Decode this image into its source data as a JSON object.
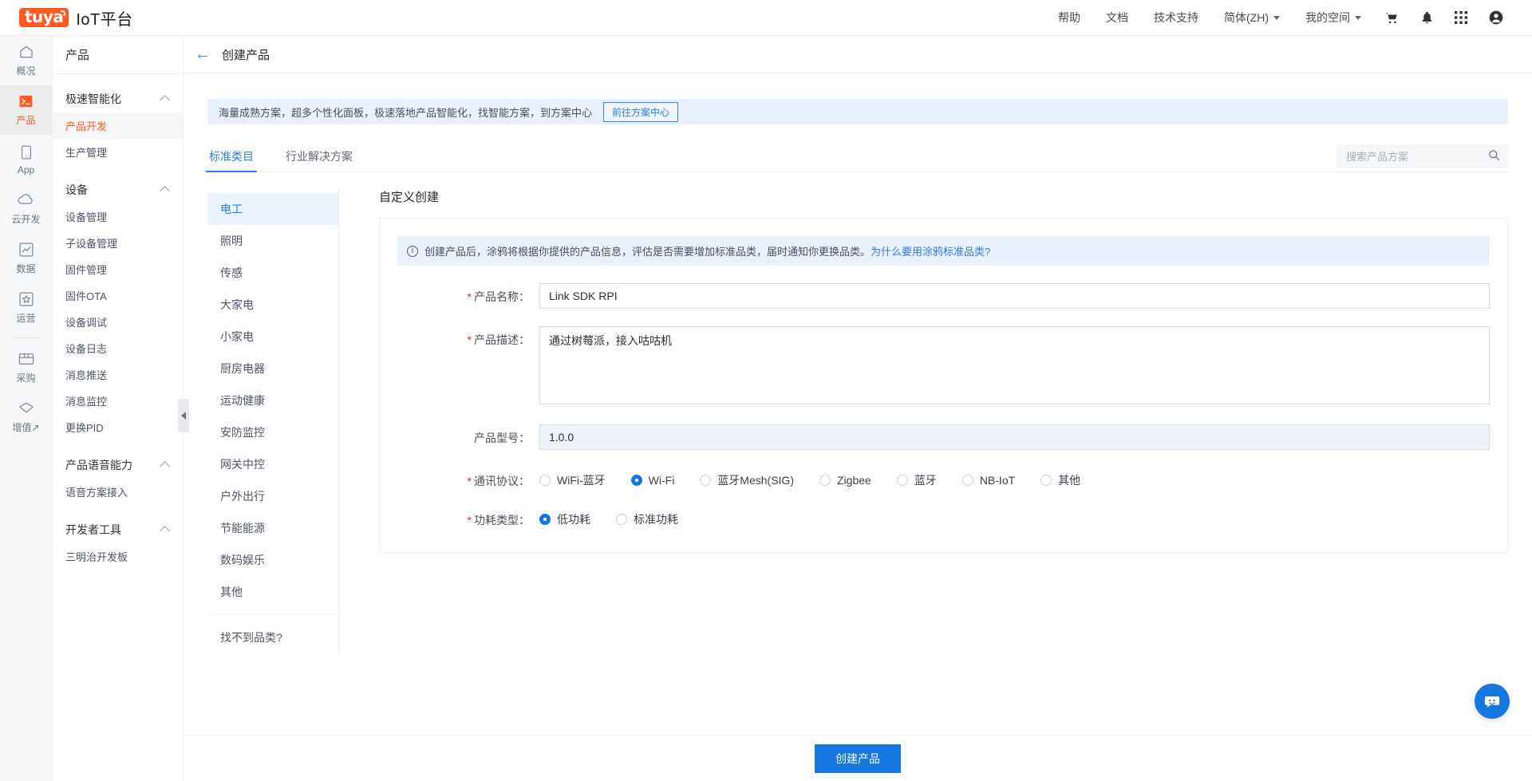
{
  "header": {
    "logo_badge": "tuya",
    "logo_text": "IoT平台",
    "nav": [
      {
        "label": "帮助",
        "name": "nav-help",
        "caret": false
      },
      {
        "label": "文档",
        "name": "nav-docs",
        "caret": false
      },
      {
        "label": "技术支持",
        "name": "nav-support",
        "caret": false
      },
      {
        "label": "简体(ZH)",
        "name": "nav-language",
        "caret": true
      },
      {
        "label": "我的空间",
        "name": "nav-workspace",
        "caret": true
      }
    ],
    "icons": [
      "cart-icon",
      "bell-icon",
      "apps-grid-icon",
      "user-avatar-icon"
    ]
  },
  "rail": {
    "items": [
      {
        "label": "概况",
        "icon": "home-icon",
        "active": false
      },
      {
        "label": "产品",
        "icon": "terminal-icon",
        "active": true
      },
      {
        "label": "App",
        "icon": "mobile-icon",
        "active": false
      },
      {
        "label": "云开发",
        "icon": "cloud-icon",
        "active": false
      },
      {
        "label": "数据",
        "icon": "chart-icon",
        "active": false
      },
      {
        "label": "运营",
        "icon": "badge-star-icon",
        "active": false
      }
    ],
    "items_bottom": [
      {
        "label": "采购",
        "icon": "box-icon",
        "active": false
      },
      {
        "label": "增值↗",
        "icon": "diamond-icon",
        "active": false
      }
    ]
  },
  "sidebar": {
    "title": "产品",
    "groups": [
      {
        "label": "极速智能化",
        "items": [
          {
            "label": "产品开发",
            "active": true
          },
          {
            "label": "生产管理",
            "active": false
          }
        ]
      },
      {
        "label": "设备",
        "items": [
          {
            "label": "设备管理",
            "active": false
          },
          {
            "label": "子设备管理",
            "active": false
          },
          {
            "label": "固件管理",
            "active": false
          },
          {
            "label": "固件OTA",
            "active": false
          },
          {
            "label": "设备调试",
            "active": false
          },
          {
            "label": "设备日志",
            "active": false
          },
          {
            "label": "消息推送",
            "active": false
          },
          {
            "label": "消息监控",
            "active": false
          },
          {
            "label": "更换PID",
            "active": false
          }
        ]
      },
      {
        "label": "产品语音能力",
        "items": [
          {
            "label": "语音方案接入",
            "active": false
          }
        ]
      },
      {
        "label": "开发者工具",
        "items": [
          {
            "label": "三明治开发板",
            "active": false
          }
        ]
      }
    ]
  },
  "page": {
    "title": "创建产品",
    "back_icon": "arrow-left-icon"
  },
  "promo": {
    "text": "海量成熟方案，超多个性化面板，极速落地产品智能化，找智能方案，到方案中心",
    "button": "前往方案中心"
  },
  "tabs": [
    {
      "label": "标准类目",
      "active": true
    },
    {
      "label": "行业解决方案",
      "active": false
    }
  ],
  "search": {
    "placeholder": "搜索产品方案",
    "value": "",
    "icon": "search-icon"
  },
  "categories": [
    {
      "label": "电工",
      "active": true
    },
    {
      "label": "照明",
      "active": false
    },
    {
      "label": "传感",
      "active": false
    },
    {
      "label": "大家电",
      "active": false
    },
    {
      "label": "小家电",
      "active": false
    },
    {
      "label": "厨房电器",
      "active": false
    },
    {
      "label": "运动健康",
      "active": false
    },
    {
      "label": "安防监控",
      "active": false
    },
    {
      "label": "网关中控",
      "active": false
    },
    {
      "label": "户外出行",
      "active": false
    },
    {
      "label": "节能能源",
      "active": false
    },
    {
      "label": "数码娱乐",
      "active": false
    },
    {
      "label": "其他",
      "active": false
    }
  ],
  "category_footer_link": "找不到品类?",
  "form": {
    "title": "自定义创建",
    "notice": {
      "icon": "info-icon",
      "text": "创建产品后，涂鸦将根据你提供的产品信息，评估是否需要增加标准品类，届时通知你更换品类。",
      "link": "为什么要用涂鸦标准品类?"
    },
    "product_name": {
      "label": "产品名称：",
      "required": true,
      "value": "Link SDK RPI",
      "placeholder": ""
    },
    "product_desc": {
      "label": "产品描述：",
      "required": true,
      "value": "通过树莓派，接入咕咕机",
      "placeholder": ""
    },
    "product_model": {
      "label": "产品型号：",
      "required": false,
      "value": "1.0.0",
      "placeholder": ""
    },
    "protocol": {
      "label": "通讯协议：",
      "required": true,
      "options": [
        {
          "label": "WiFi-蓝牙",
          "selected": false
        },
        {
          "label": "Wi-Fi",
          "selected": true
        },
        {
          "label": "蓝牙Mesh(SIG)",
          "selected": false
        },
        {
          "label": "Zigbee",
          "selected": false
        },
        {
          "label": "蓝牙",
          "selected": false
        },
        {
          "label": "NB-IoT",
          "selected": false
        },
        {
          "label": "其他",
          "selected": false
        }
      ]
    },
    "power_type": {
      "label": "功耗类型：",
      "required": true,
      "options": [
        {
          "label": "低功耗",
          "selected": true
        },
        {
          "label": "标准功耗",
          "selected": false
        }
      ]
    }
  },
  "footer": {
    "submit_label": "创建产品"
  },
  "chat": {
    "icon": "chat-support-icon"
  },
  "colors": {
    "brand_orange": "#ff5a1f",
    "accent_blue": "#1677e0",
    "link_blue": "#2f7de1",
    "required_red": "#d93026",
    "info_bg": "#e8f1fd"
  }
}
